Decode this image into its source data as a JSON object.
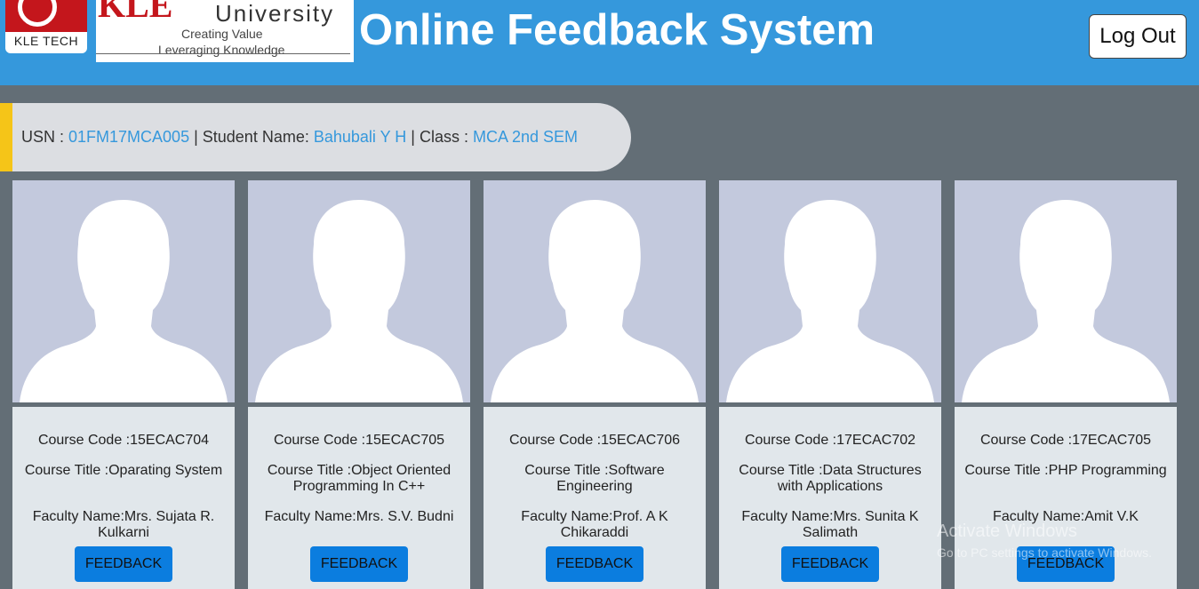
{
  "header": {
    "logo_text": "KLE TECH",
    "university_brand": "KLE",
    "university_word": "University",
    "tagline_1": "Creating Value",
    "tagline_2": "Leveraging Knowledge",
    "title": "Online Feedback System",
    "logout_label": "Log Out",
    "color": "#3598dc"
  },
  "student": {
    "usn_label": "USN : ",
    "usn": "01FM17MCA005",
    "name_label": " | Student Name: ",
    "name": "Bahubali Y H",
    "class_label": " | Class : ",
    "class": "MCA 2nd SEM"
  },
  "courses": [
    {
      "code": "Course Code :15ECAC704",
      "title": "Course Title :Oparating System",
      "faculty": "Faculty Name:Mrs. Sujata R. Kulkarni",
      "button": "FEEDBACK"
    },
    {
      "code": "Course Code :15ECAC705",
      "title": "Course Title :Object Oriented Programming In C++",
      "faculty": "Faculty Name:Mrs. S.V. Budni",
      "button": "FEEDBACK"
    },
    {
      "code": "Course Code :15ECAC706",
      "title": "Course Title :Software Engineering",
      "faculty": "Faculty Name:Prof. A K Chikaraddi",
      "button": "FEEDBACK"
    },
    {
      "code": "Course Code :17ECAC702",
      "title": "Course Title :Data Structures with Applications",
      "faculty": "Faculty Name:Mrs. Sunita K Salimath",
      "button": "FEEDBACK"
    },
    {
      "code": "Course Code :17ECAC705",
      "title": "Course Title :PHP Programming",
      "faculty": "Faculty Name:Amit V.K",
      "button": "FEEDBACK"
    }
  ],
  "watermark": {
    "line1": "Activate Windows",
    "line2": "Go to PC settings to activate Windows."
  },
  "colors": {
    "background": "#636e76",
    "accent_yellow": "#f5c518",
    "button_blue": "#0b7ddf",
    "value_blue": "#3598dc"
  }
}
